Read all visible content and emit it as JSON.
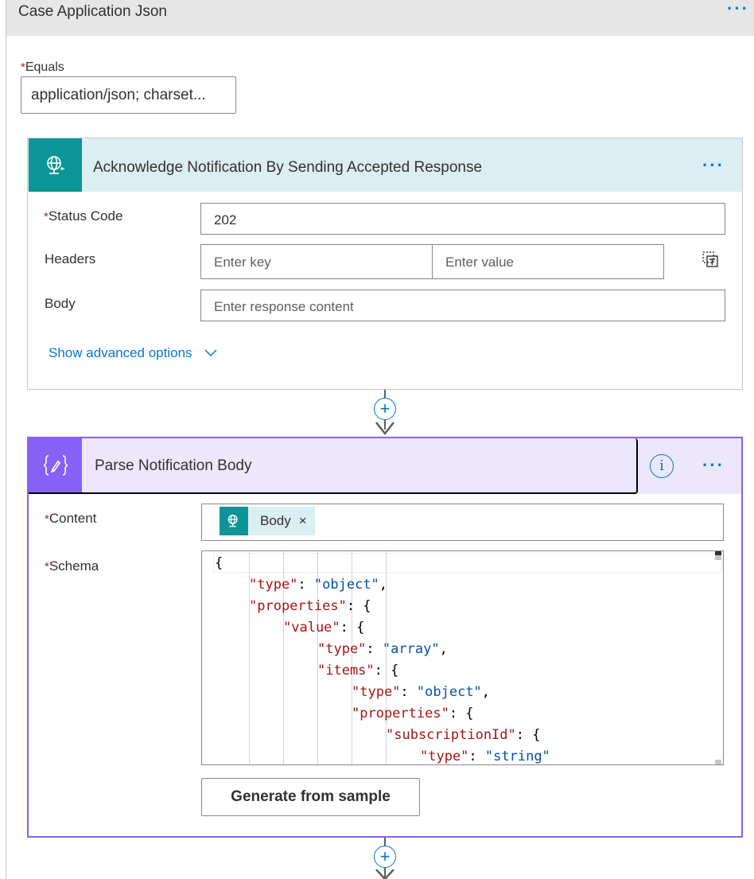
{
  "case": {
    "title": "Case Application Json",
    "more_label": "···",
    "equals_label": "Equals",
    "equals_value": "application/json; charset..."
  },
  "response_action": {
    "title": "Acknowledge Notification By Sending Accepted Response",
    "more_label": "···",
    "icon": "globe-response-icon",
    "accent_color": "#0b9596",
    "status_code_label": "Status Code",
    "status_code_value": "202",
    "headers_label": "Headers",
    "header_key_placeholder": "Enter key",
    "header_value_placeholder": "Enter value",
    "body_label": "Body",
    "body_placeholder": "Enter response content",
    "advanced_link": "Show advanced options"
  },
  "connector": {
    "add_label": "+"
  },
  "parse_action": {
    "title": "Parse Notification Body",
    "more_label": "···",
    "icon": "code-braces-icon",
    "accent_color": "#8661f5",
    "info_label": "i",
    "content_label": "Content",
    "content_token": "Body",
    "token_remove": "×",
    "schema_label": "Schema",
    "schema_lines": [
      "{",
      "\"type\": \"object\",",
      "\"properties\": {",
      "\"value\": {",
      "\"type\": \"array\",",
      "\"items\": {",
      "\"type\": \"object\",",
      "\"properties\": {",
      "\"subscriptionId\": {",
      "\"type\": \"string\""
    ],
    "generate_button": "Generate from sample"
  }
}
